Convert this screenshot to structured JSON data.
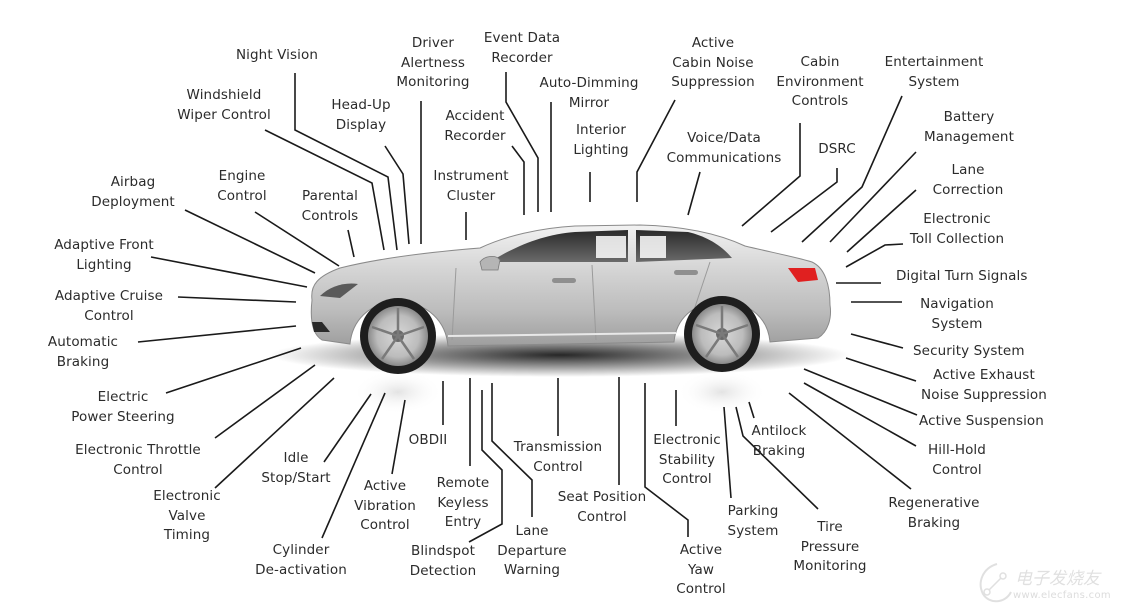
{
  "diagram": {
    "subject": "Automotive electronic systems",
    "vehicle": "silver sedan (side view)",
    "labels": {
      "night_vision": "Night Vision",
      "windshield_wiper": "Windshield\nWiper Control",
      "head_up": "Head-Up\nDisplay",
      "driver_alertness": "Driver\nAlertness\nMonitoring",
      "event_data": "Event Data\nRecorder",
      "accident_recorder": "Accident\nRecorder",
      "instrument_cluster": "Instrument\nCluster",
      "auto_dimming": "Auto-Dimming\nMirror",
      "interior_lighting": "Interior\nLighting",
      "active_cabin_noise": "Active\nCabin Noise\nSuppression",
      "voice_data": "Voice/Data\nCommunications",
      "cabin_environment": "Cabin\nEnvironment\nControls",
      "dsrc": "DSRC",
      "entertainment": "Entertainment\nSystem",
      "battery": "Battery\nManagement",
      "lane_correction": "Lane\nCorrection",
      "toll": "Electronic\nToll Collection",
      "turn_signals": "Digital Turn Signals",
      "navigation": "Navigation\nSystem",
      "security": "Security System",
      "active_exhaust": "Active Exhaust\nNoise Suppression",
      "active_suspension": "Active Suspension",
      "hill_hold": "Hill-Hold\nControl",
      "regenerative": "Regenerative\nBraking",
      "tire_pressure": "Tire\nPressure\nMonitoring",
      "antilock": "Antilock\nBraking",
      "parking": "Parking\nSystem",
      "active_yaw": "Active\nYaw\nControl",
      "stability": "Electronic\nStability\nControl",
      "seat_position": "Seat Position\nControl",
      "transmission": "Transmission\nControl",
      "lane_departure": "Lane\nDeparture\nWarning",
      "blindspot": "Blindspot\nDetection",
      "remote_keyless": "Remote\nKeyless\nEntry",
      "obdii": "OBDII",
      "active_vibration": "Active\nVibration\nControl",
      "cylinder": "Cylinder\nDe-activation",
      "idle_stop": "Idle\nStop/Start",
      "valve_timing": "Electronic\nValve\nTiming",
      "throttle": "Electronic Throttle\nControl",
      "power_steering": "Electric\nPower Steering",
      "auto_braking": "Automatic\nBraking",
      "adaptive_cruise": "Adaptive Cruise\nControl",
      "adaptive_front": "Adaptive Front\nLighting",
      "airbag": "Airbag\nDeployment",
      "engine_control": "Engine\nControl",
      "parental": "Parental\nControls"
    },
    "colors": {
      "text": "#2b2b2b",
      "leader": "#1a1a1a",
      "car_body": "#c9c9c9",
      "taillight": "#e02020"
    }
  },
  "watermark": {
    "brand": "电子发烧友",
    "url": "www.elecfans.com"
  }
}
